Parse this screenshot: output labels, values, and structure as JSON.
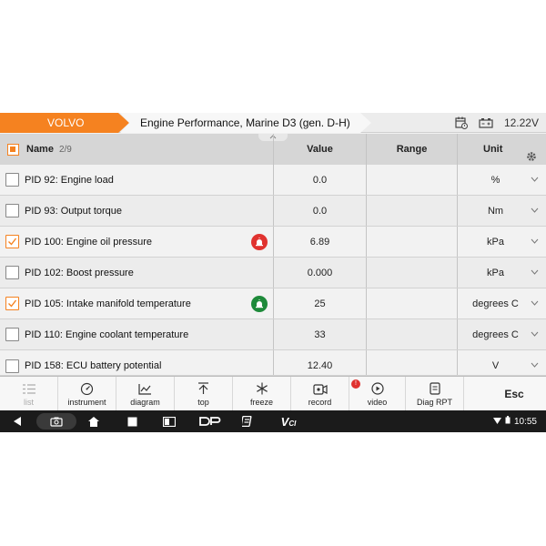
{
  "header": {
    "brand": "VOLVO",
    "path": "Engine Performance, Marine D3 (gen. D-H)",
    "battery_voltage": "12.22V"
  },
  "table": {
    "headers": {
      "name": "Name",
      "count": "2/9",
      "value": "Value",
      "range": "Range",
      "unit": "Unit"
    },
    "rows": [
      {
        "label": "PID 92: Engine load",
        "value": "0.0",
        "range": "",
        "unit": "%",
        "checked": false,
        "alarm": ""
      },
      {
        "label": "PID 93: Output torque",
        "value": "0.0",
        "range": "",
        "unit": "Nm",
        "checked": false,
        "alarm": ""
      },
      {
        "label": "PID 100: Engine oil pressure",
        "value": "6.89",
        "range": "",
        "unit": "kPa",
        "checked": true,
        "alarm": "red"
      },
      {
        "label": "PID 102: Boost pressure",
        "value": "0.000",
        "range": "",
        "unit": "kPa",
        "checked": false,
        "alarm": ""
      },
      {
        "label": "PID 105: Intake manifold temperature",
        "value": "25",
        "range": "",
        "unit": "degrees C",
        "checked": true,
        "alarm": "green"
      },
      {
        "label": "PID 110: Engine coolant temperature",
        "value": "33",
        "range": "",
        "unit": "degrees C",
        "checked": false,
        "alarm": ""
      },
      {
        "label": "PID 158: ECU battery potential",
        "value": "12.40",
        "range": "",
        "unit": "V",
        "checked": false,
        "alarm": ""
      }
    ]
  },
  "toolbar": {
    "list": "list",
    "instrument": "instrument",
    "diagram": "diagram",
    "top": "top",
    "freeze": "freeze",
    "record": "record",
    "record_badge": "!",
    "video": "video",
    "diag_rpt": "Diag RPT",
    "esc": "Esc"
  },
  "navbar": {
    "time": "10:55",
    "vci_label": "V",
    "vci_sub": "CI"
  },
  "colors": {
    "accent": "#f58220",
    "alarm_red": "#e0322f",
    "alarm_green": "#1e8a3a"
  }
}
